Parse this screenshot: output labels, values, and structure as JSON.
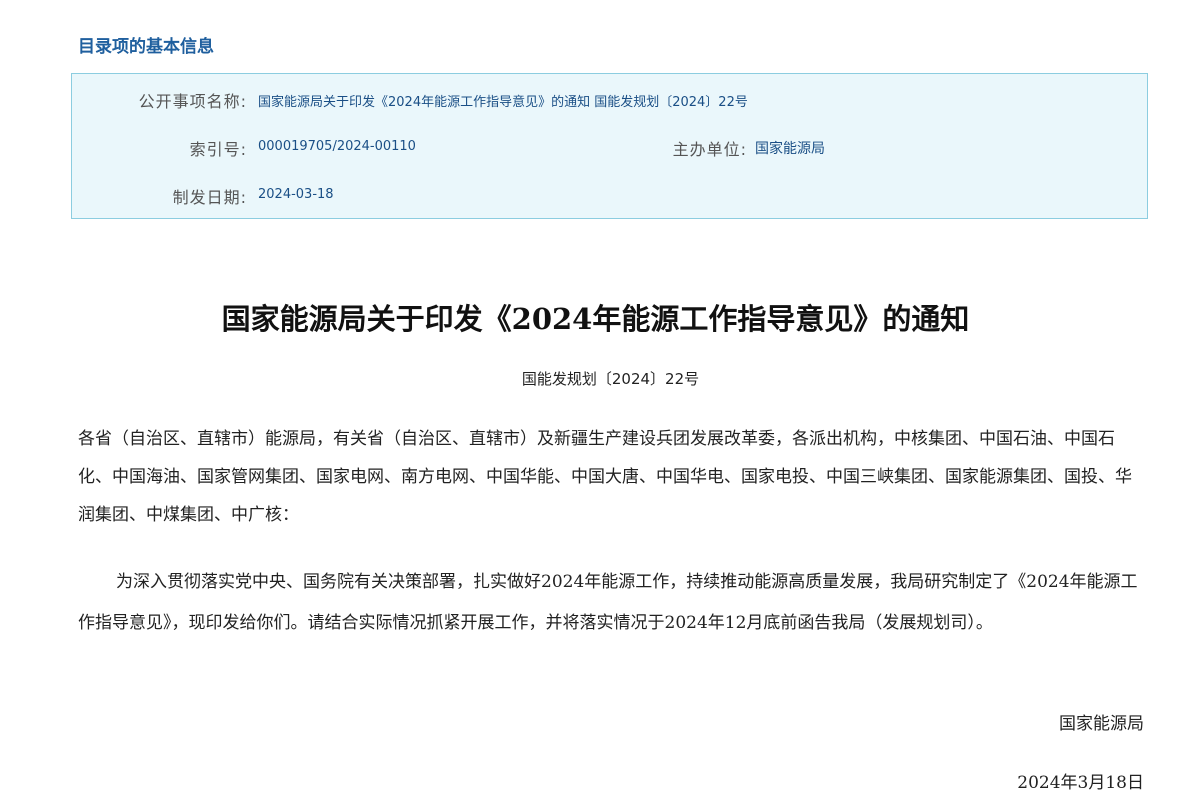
{
  "catalog": {
    "heading": "目录项的基本信息",
    "fields": {
      "public_item_name_label": "公开事项名称:",
      "public_item_name_value": "国家能源局关于印发《2024年能源工作指导意见》的通知 国能发规划〔2024〕22号",
      "index_label": "索引号:",
      "index_value": "000019705/2024-00110",
      "host_unit_label": "主办单位:",
      "host_unit_value": "国家能源局",
      "date_label": "制发日期:",
      "date_value": "2024-03-18"
    }
  },
  "document": {
    "title": "国家能源局关于印发《2024年能源工作指导意见》的通知",
    "number": "国能发规划〔2024〕22号",
    "addressee": "各省（自治区、直辖市）能源局，有关省（自治区、直辖市）及新疆生产建设兵团发展改革委，各派出机构，中核集团、中国石油、中国石化、中国海油、国家管网集团、国家电网、南方电网、中国华能、中国大唐、中国华电、国家电投、中国三峡集团、国家能源集团、国投、华润集团、中煤集团、中广核：",
    "body": "为深入贯彻落实党中央、国务院有关决策部署，扎实做好2024年能源工作，持续推动能源高质量发展，我局研究制定了《2024年能源工作指导意见》，现印发给你们。请结合实际情况抓紧开展工作，并将落实情况于2024年12月底前函告我局（发展规划司）。",
    "signature": "国家能源局",
    "date": "2024年3月18日"
  }
}
